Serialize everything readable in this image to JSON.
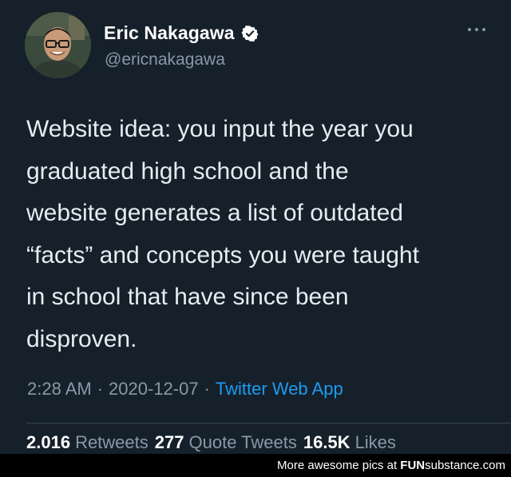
{
  "tweet": {
    "author": {
      "display_name": "Eric Nakagawa",
      "handle": "@ericnakagawa",
      "verified": true
    },
    "text": "Website idea: you input the year you\ngraduated high school and the\nwebsite generates a list of outdated\n“facts” and concepts you were taught\nin school that have since been\ndisproven.",
    "time": "2:28 AM",
    "date": "2020-12-07",
    "source": "Twitter Web App",
    "separator": "·",
    "stats": {
      "retweets_count": "2.016",
      "retweets_label": "Retweets",
      "quotes_count": "277",
      "quotes_label": "Quote Tweets",
      "likes_count": "16.5K",
      "likes_label": "Likes"
    }
  },
  "icons": {
    "verified": "verified-badge-icon",
    "more": "more-options-icon"
  },
  "colors": {
    "background": "#15202b",
    "secondary_text": "#8899a6",
    "link": "#1d9bf0"
  },
  "footer": {
    "prefix": "More awesome pics at ",
    "brand_bold": "FUN",
    "brand_rest": "substance.com"
  }
}
